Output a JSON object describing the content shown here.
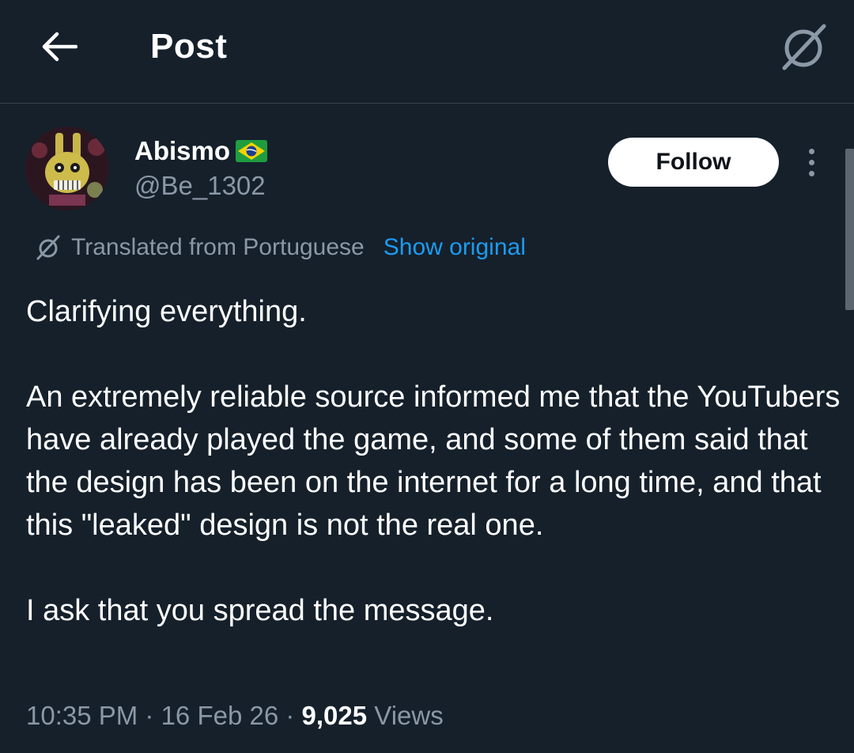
{
  "header": {
    "title": "Post",
    "back_icon": "arrow-left-icon",
    "translate_icon": "translate-slash-icon"
  },
  "author": {
    "name": "Abismo",
    "flag_icon": "brazil-flag-icon",
    "handle": "@Be_1302",
    "follow_label": "Follow"
  },
  "translation": {
    "label": "Translated from Portuguese",
    "show_original": "Show original"
  },
  "post": {
    "paragraphs": [
      "Clarifying everything.",
      "An extremely reliable source informed me that the YouTubers have already played the game, and some of them said that the design has been on the internet for a long time, and that this \"leaked\" design is not the real one.",
      "I ask that you spread the message."
    ]
  },
  "meta": {
    "time": "10:35 PM",
    "sep1": " · ",
    "date": "16 Feb 26",
    "sep2": " · ",
    "views_count": "9,025",
    "views_label": " Views"
  },
  "colors": {
    "background": "#15202b",
    "secondary_text": "#8b98a5",
    "link": "#1d9bf0"
  }
}
